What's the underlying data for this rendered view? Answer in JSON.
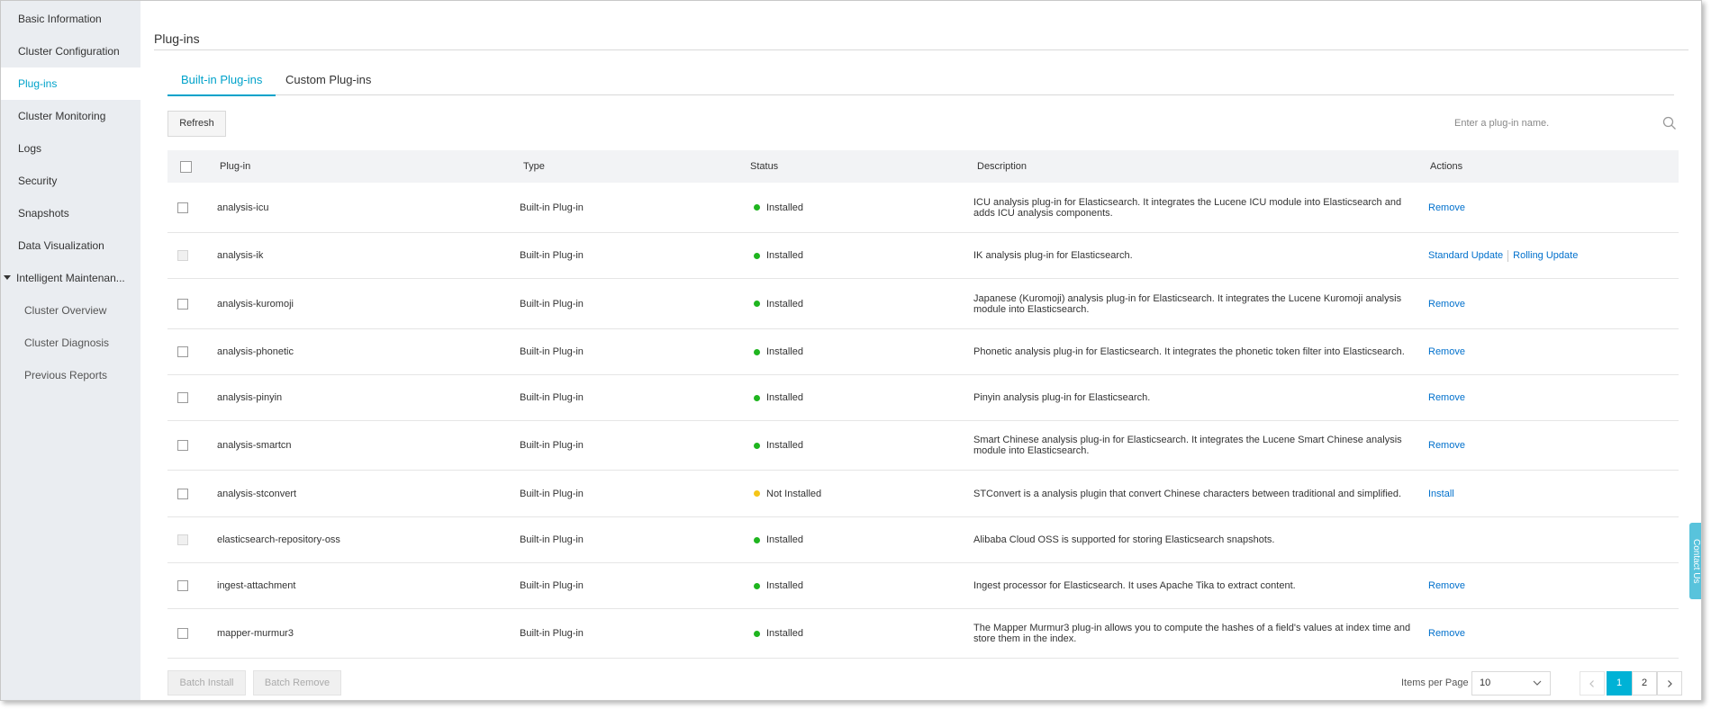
{
  "sidebar": {
    "items": [
      {
        "label": "Basic Information"
      },
      {
        "label": "Cluster Configuration"
      },
      {
        "label": "Plug-ins"
      },
      {
        "label": "Cluster Monitoring"
      },
      {
        "label": "Logs"
      },
      {
        "label": "Security"
      },
      {
        "label": "Snapshots"
      },
      {
        "label": "Data Visualization"
      },
      {
        "label": "Intelligent Maintenan..."
      },
      {
        "label": "Cluster Overview"
      },
      {
        "label": "Cluster Diagnosis"
      },
      {
        "label": "Previous Reports"
      }
    ]
  },
  "page": {
    "title": "Plug-ins"
  },
  "tabs": [
    {
      "label": "Built-in Plug-ins"
    },
    {
      "label": "Custom Plug-ins"
    }
  ],
  "toolbar": {
    "refresh_label": "Refresh",
    "search_placeholder": "Enter a plug-in name."
  },
  "table": {
    "columns": [
      "Plug-in",
      "Type",
      "Status",
      "Description",
      "Actions"
    ],
    "rows": [
      {
        "name": "analysis-icu",
        "type": "Built-in Plug-in",
        "status": "Installed",
        "description": "ICU analysis plug-in for Elasticsearch. It integrates the Lucene ICU module into Elasticsearch and adds ICU analysis components.",
        "actions": [
          "Remove"
        ]
      },
      {
        "name": "analysis-ik",
        "type": "Built-in Plug-in",
        "status": "Installed",
        "description": "IK analysis plug-in for Elasticsearch.",
        "actions": [
          "Standard Update",
          "Rolling Update"
        ]
      },
      {
        "name": "analysis-kuromoji",
        "type": "Built-in Plug-in",
        "status": "Installed",
        "description": "Japanese (Kuromoji) analysis plug-in for Elasticsearch. It integrates the Lucene Kuromoji analysis module into Elasticsearch.",
        "actions": [
          "Remove"
        ]
      },
      {
        "name": "analysis-phonetic",
        "type": "Built-in Plug-in",
        "status": "Installed",
        "description": "Phonetic analysis plug-in for Elasticsearch. It integrates the phonetic token filter into Elasticsearch.",
        "actions": [
          "Remove"
        ]
      },
      {
        "name": "analysis-pinyin",
        "type": "Built-in Plug-in",
        "status": "Installed",
        "description": "Pinyin analysis plug-in for Elasticsearch.",
        "actions": [
          "Remove"
        ]
      },
      {
        "name": "analysis-smartcn",
        "type": "Built-in Plug-in",
        "status": "Installed",
        "description": "Smart Chinese analysis plug-in for Elasticsearch. It integrates the Lucene Smart Chinese analysis module into Elasticsearch.",
        "actions": [
          "Remove"
        ]
      },
      {
        "name": "analysis-stconvert",
        "type": "Built-in Plug-in",
        "status": "Not Installed",
        "description": "STConvert is a analysis plugin that convert Chinese characters between traditional and simplified.",
        "actions": [
          "Install"
        ]
      },
      {
        "name": "elasticsearch-repository-oss",
        "type": "Built-in Plug-in",
        "status": "Installed",
        "description": "Alibaba Cloud OSS is supported for storing Elasticsearch snapshots.",
        "actions": []
      },
      {
        "name": "ingest-attachment",
        "type": "Built-in Plug-in",
        "status": "Installed",
        "description": "Ingest processor for Elasticsearch. It uses Apache Tika to extract content.",
        "actions": [
          "Remove"
        ]
      },
      {
        "name": "mapper-murmur3",
        "type": "Built-in Plug-in",
        "status": "Installed",
        "description": "The Mapper Murmur3 plug-in allows you to compute the hashes of a field's values at index time and store them in the index.",
        "actions": [
          "Remove"
        ]
      }
    ]
  },
  "footer": {
    "batch_install_label": "Batch Install",
    "batch_remove_label": "Batch Remove",
    "items_per_page_label": "Items per Page",
    "items_per_page_value": "10",
    "pages": [
      "1",
      "2"
    ],
    "current_page": "1"
  },
  "contact_us": "Contact Us",
  "colors": {
    "accent": "#00a2ca",
    "installed": "#1fb51f",
    "not_installed": "#f5c518",
    "link": "#0070cc"
  }
}
